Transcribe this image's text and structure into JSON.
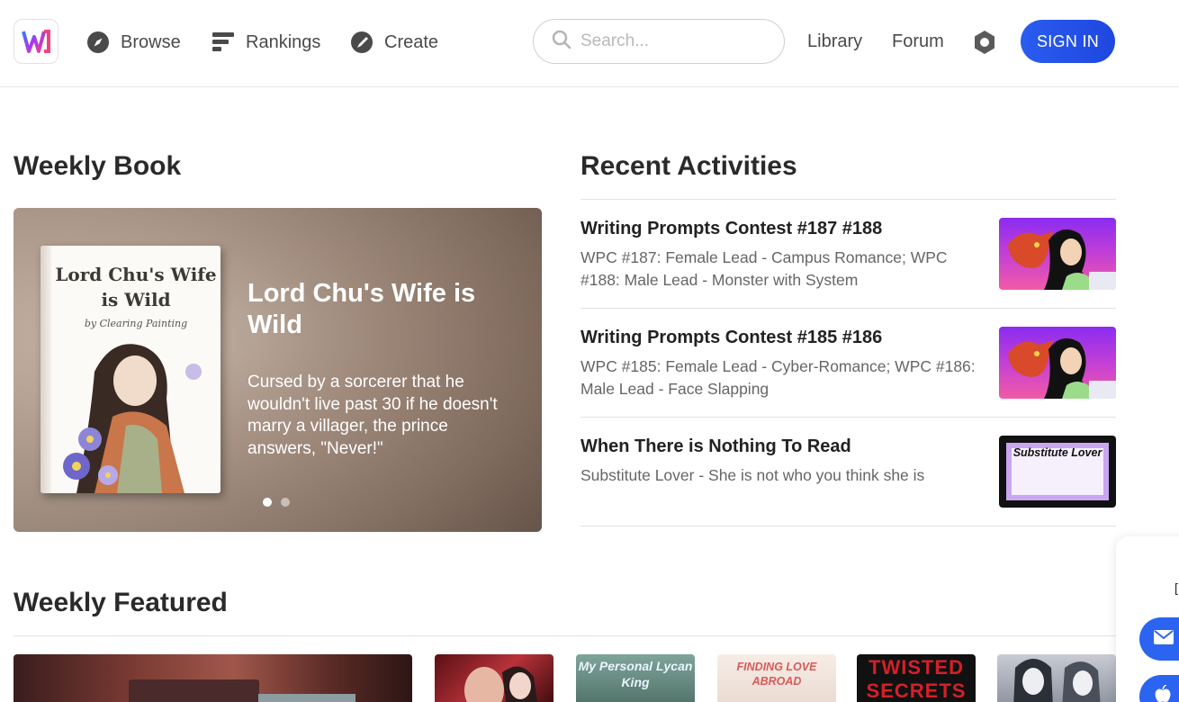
{
  "header": {
    "nav": {
      "browse": "Browse",
      "rankings": "Rankings",
      "create": "Create"
    },
    "search": {
      "placeholder": "Search..."
    },
    "library": "Library",
    "forum": "Forum",
    "sign_in": "SIGN IN",
    "accent_color": "#1e47e0"
  },
  "weekly_book": {
    "section_title": "Weekly Book",
    "cover_title": "Lord Chu's Wife is Wild",
    "cover_author": "by Clearing Painting",
    "title": "Lord Chu's Wife is Wild",
    "description": "Cursed by a sorcerer that he wouldn't live past 30 if he doesn't marry a villager, the prince answers, \"Never!\"",
    "carousel_active_index": 0,
    "carousel_count": 2
  },
  "recent_activities": {
    "section_title": "Recent Activities",
    "items": [
      {
        "title": "Writing Prompts Contest #187 #188",
        "description": "WPC #187: Female Lead - Campus Romance; WPC #188: Male Lead - Monster with System"
      },
      {
        "title": "Writing Prompts Contest #185 #186",
        "description": "WPC #185: Female Lead - Cyber-Romance; WPC #186: Male Lead - Face Slapping"
      },
      {
        "title": "When There is Nothing To Read",
        "description": "Substitute Lover - She is not who you think she is",
        "thumb_text": "Substitute Lover"
      }
    ]
  },
  "weekly_featured": {
    "section_title": "Weekly Featured",
    "covers": [
      {
        "text": ""
      },
      {
        "text": "My Personal Lycan King"
      },
      {
        "text": "FINDING LOVE ABROAD"
      },
      {
        "text": "TWISTED SECRETS"
      }
    ]
  },
  "float_panel": {
    "text": "["
  }
}
